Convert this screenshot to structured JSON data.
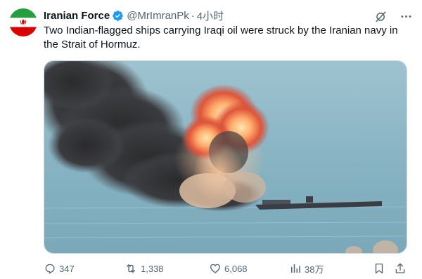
{
  "tweet": {
    "author": {
      "display_name": "Iranian Force",
      "handle": "@MrImranPk",
      "separator": "·",
      "time_ago": "4小时",
      "verified": true
    },
    "text": "Two Indian-flagged ships carrying Iraqi oil were struck by the Iranian navy in the Strait of Hormuz.",
    "media": {
      "type": "image",
      "avatar_flag_colors": [
        "#239f40",
        "#ffffff",
        "#da0000"
      ]
    },
    "actions": {
      "replies": "347",
      "retweets": "1,338",
      "likes": "6,068",
      "views": "38万"
    },
    "icons": {
      "grok": "grok-icon",
      "more": "more-icon",
      "reply": "reply-icon",
      "retweet": "retweet-icon",
      "like": "heart-icon",
      "views": "views-icon",
      "bookmark": "bookmark-icon",
      "share": "share-icon"
    }
  }
}
